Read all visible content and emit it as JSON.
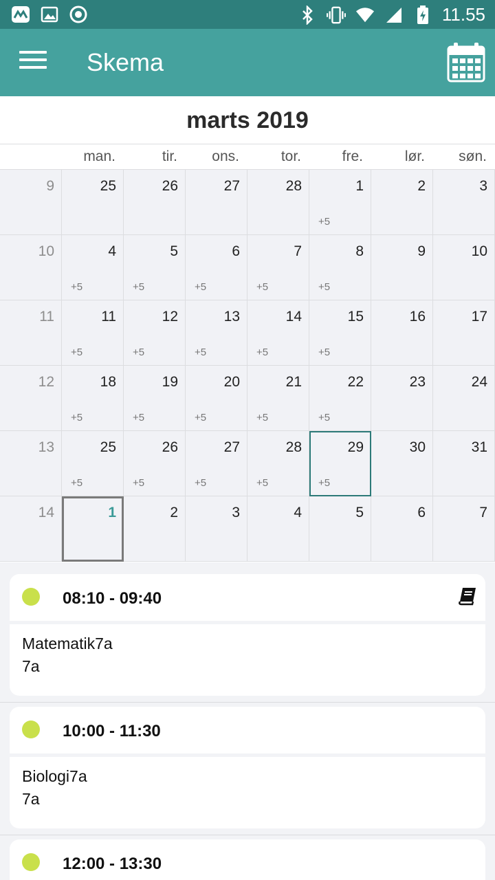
{
  "status_bar": {
    "time": "11.55",
    "left_icons": [
      "app-notification-icon",
      "image-notification-icon",
      "sync-notification-icon"
    ],
    "right_icons": [
      "bluetooth-icon",
      "vibrate-icon",
      "wifi-icon",
      "signal-icon",
      "battery-charging-icon"
    ]
  },
  "app_bar": {
    "title": "Skema",
    "menu_icon": "hamburger-menu-icon",
    "action_icon": "calendar-icon",
    "color": "#45a29e"
  },
  "calendar": {
    "month_title": "marts 2019",
    "weekdays": [
      "man.",
      "tir.",
      "ons.",
      "tor.",
      "fre.",
      "lør.",
      "søn."
    ],
    "weeks": [
      {
        "week": "9",
        "days": [
          {
            "d": "25",
            "more": ""
          },
          {
            "d": "26",
            "more": ""
          },
          {
            "d": "27",
            "more": ""
          },
          {
            "d": "28",
            "more": ""
          },
          {
            "d": "1",
            "more": "+5"
          },
          {
            "d": "2",
            "more": ""
          },
          {
            "d": "3",
            "more": ""
          }
        ]
      },
      {
        "week": "10",
        "days": [
          {
            "d": "4",
            "more": "+5"
          },
          {
            "d": "5",
            "more": "+5"
          },
          {
            "d": "6",
            "more": "+5"
          },
          {
            "d": "7",
            "more": "+5"
          },
          {
            "d": "8",
            "more": "+5"
          },
          {
            "d": "9",
            "more": ""
          },
          {
            "d": "10",
            "more": ""
          }
        ]
      },
      {
        "week": "11",
        "days": [
          {
            "d": "11",
            "more": "+5"
          },
          {
            "d": "12",
            "more": "+5"
          },
          {
            "d": "13",
            "more": "+5"
          },
          {
            "d": "14",
            "more": "+5"
          },
          {
            "d": "15",
            "more": "+5"
          },
          {
            "d": "16",
            "more": ""
          },
          {
            "d": "17",
            "more": ""
          }
        ]
      },
      {
        "week": "12",
        "days": [
          {
            "d": "18",
            "more": "+5"
          },
          {
            "d": "19",
            "more": "+5"
          },
          {
            "d": "20",
            "more": "+5"
          },
          {
            "d": "21",
            "more": "+5"
          },
          {
            "d": "22",
            "more": "+5"
          },
          {
            "d": "23",
            "more": ""
          },
          {
            "d": "24",
            "more": ""
          }
        ]
      },
      {
        "week": "13",
        "days": [
          {
            "d": "25",
            "more": "+5"
          },
          {
            "d": "26",
            "more": "+5"
          },
          {
            "d": "27",
            "more": "+5"
          },
          {
            "d": "28",
            "more": "+5"
          },
          {
            "d": "29",
            "more": "+5",
            "selected": true
          },
          {
            "d": "30",
            "more": ""
          },
          {
            "d": "31",
            "more": ""
          }
        ]
      },
      {
        "week": "14",
        "days": [
          {
            "d": "1",
            "more": "",
            "today": true
          },
          {
            "d": "2",
            "more": ""
          },
          {
            "d": "3",
            "more": ""
          },
          {
            "d": "4",
            "more": ""
          },
          {
            "d": "5",
            "more": ""
          },
          {
            "d": "6",
            "more": ""
          },
          {
            "d": "7",
            "more": ""
          }
        ]
      }
    ]
  },
  "events": [
    {
      "time": "08:10 - 09:40",
      "line1": "Matematik7a",
      "line2": "7a",
      "dot_color": "#c9e04b",
      "icon": "book-icon"
    },
    {
      "time": "10:00 - 11:30",
      "line1": "Biologi7a",
      "line2": "7a",
      "dot_color": "#c9e04b",
      "icon": ""
    },
    {
      "time": "12:00 - 13:30",
      "line1": "",
      "line2": "",
      "dot_color": "#c9e04b",
      "icon": ""
    }
  ]
}
